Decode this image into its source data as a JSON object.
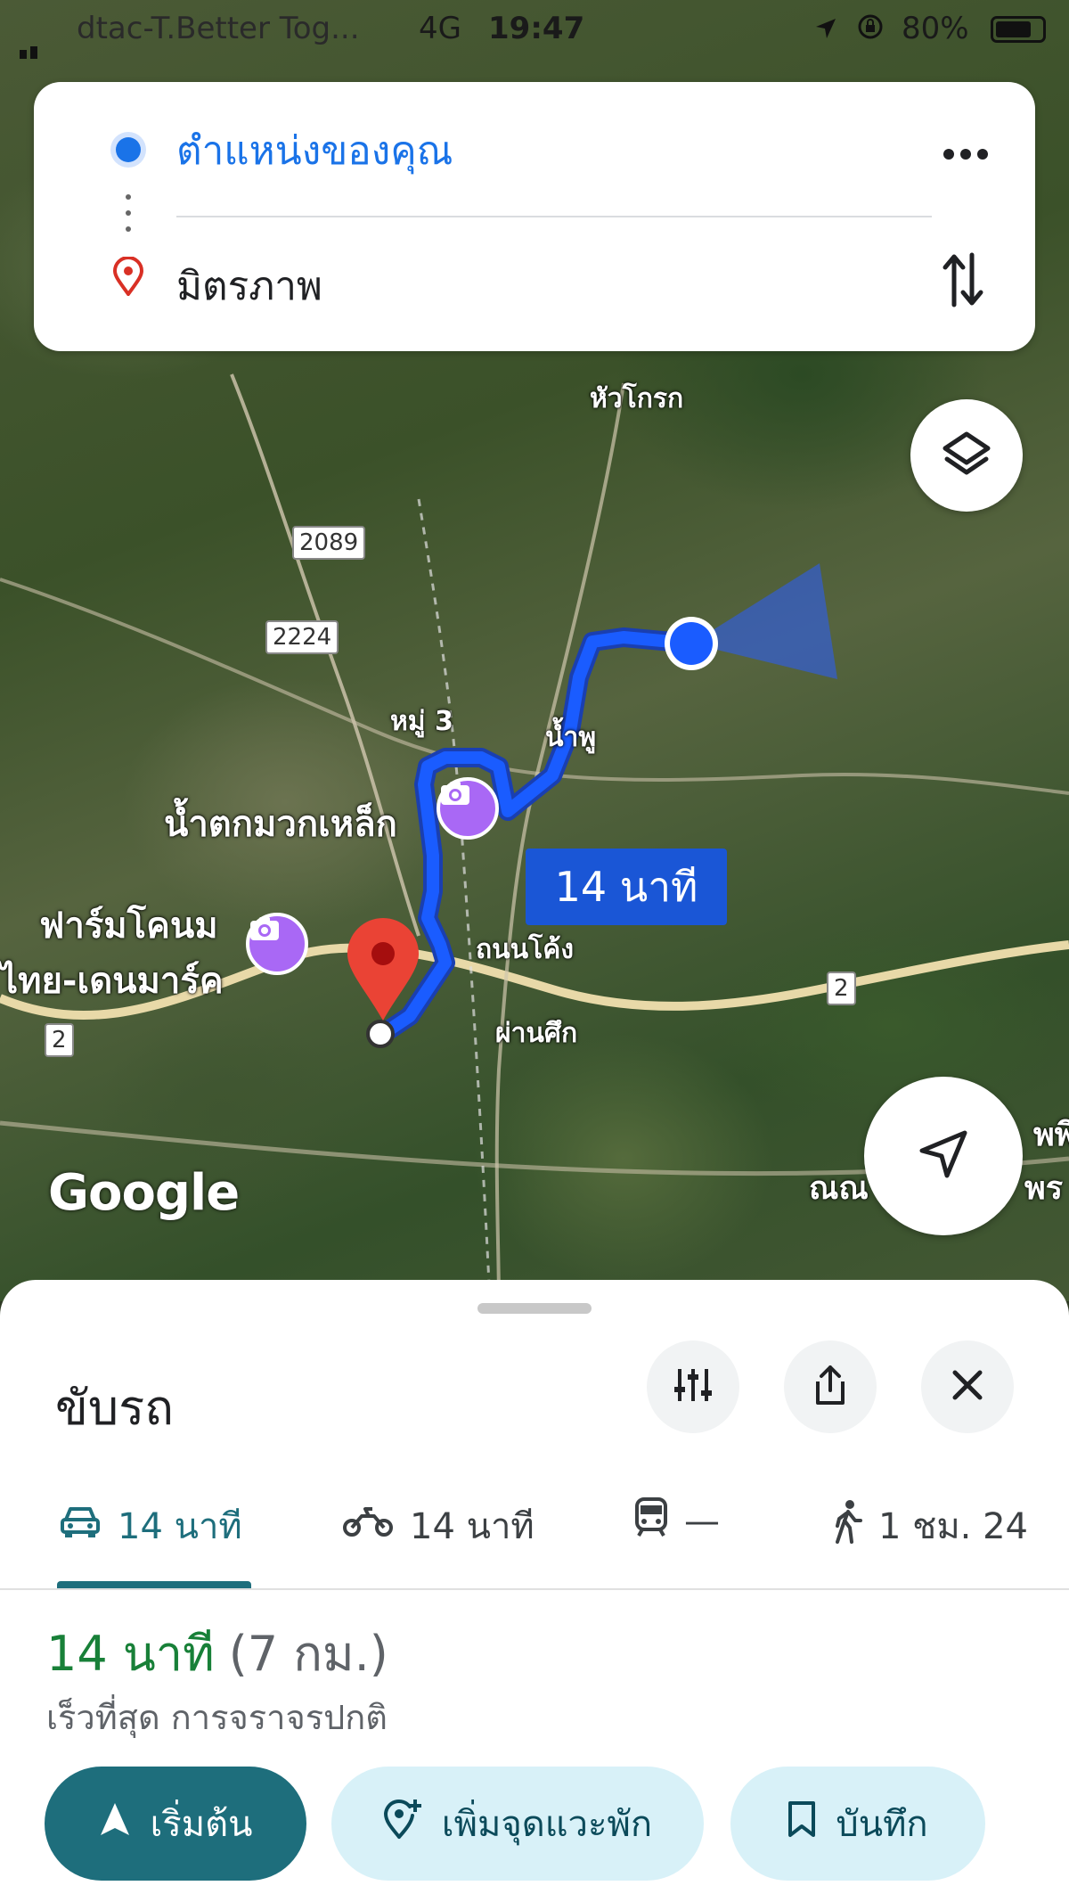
{
  "status_bar": {
    "carrier": "dtac-T.Better Tog...",
    "network": "4G",
    "time": "19:47",
    "battery": "80%",
    "battery_level": 0.8
  },
  "route_card": {
    "origin": "ตำแหน่งของคุณ",
    "destination": "มิตรภาพ",
    "more_icon": "more-horiz-icon",
    "swap_icon": "swap-vertical-icon"
  },
  "map": {
    "labels": {
      "hua_khok": "หัวโกรก",
      "mu3": "หมู่ 3",
      "nam_phu": "น้ำพู",
      "waterfall": "น้ำตกมวกเหล็ก",
      "farm_line1": "ฟาร์มโคนม",
      "farm_line2": "ไทย-เดนมาร์ค",
      "thanon_khong": "ถนนโค้ง",
      "phan_suek": "ผ่านศึก",
      "right_edge_1": "พพิ",
      "right_edge_2": "ณณ",
      "right_edge_3": "พร"
    },
    "shields": [
      "2089",
      "2224",
      "2",
      "2"
    ],
    "eta_bubble": "14 นาที",
    "attribution": "Google",
    "route_color": "#1a5cff"
  },
  "sheet": {
    "title": "ขับรถ",
    "options_icon": "tune-icon",
    "share_icon": "share-icon",
    "close_icon": "close-icon",
    "modes": [
      {
        "icon": "car-icon",
        "label": "14 นาที",
        "active": true
      },
      {
        "icon": "motorcycle-icon",
        "label": "14 นาที"
      },
      {
        "icon": "transit-icon",
        "label": "—"
      },
      {
        "icon": "walk-icon",
        "label": "1 ชม. 24"
      }
    ],
    "duration": "14 นาที",
    "distance": "(7 กม.)",
    "description": "เร็วที่สุด การจราจรปกติ",
    "actions": {
      "start": "เริ่มต้น",
      "add_stop": "เพิ่มจุดแวะพัก",
      "save": "บันทึก"
    },
    "accent": "#1e6e7c"
  }
}
